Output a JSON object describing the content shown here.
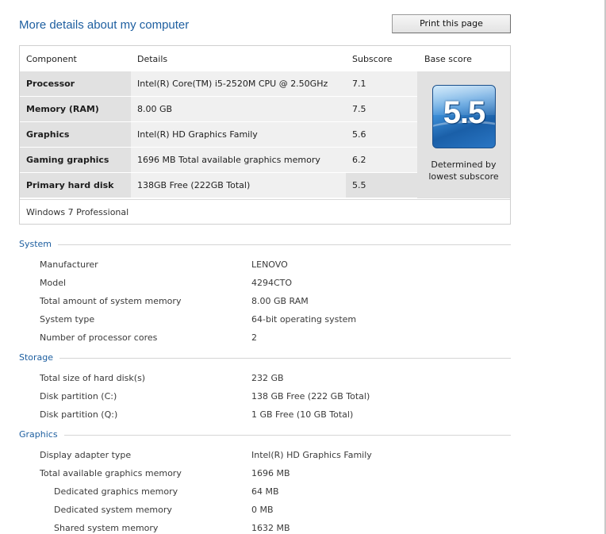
{
  "header": {
    "title": "More details about my computer",
    "print_label": "Print this page"
  },
  "score_table": {
    "columns": [
      "Component",
      "Details",
      "Subscore",
      "Base score"
    ],
    "rows": [
      {
        "component": "Processor",
        "details": "Intel(R) Core(TM) i5-2520M CPU @ 2.50GHz",
        "subscore": "7.1"
      },
      {
        "component": "Memory (RAM)",
        "details": "8.00 GB",
        "subscore": "7.5"
      },
      {
        "component": "Graphics",
        "details": "Intel(R) HD Graphics Family",
        "subscore": "5.6"
      },
      {
        "component": "Gaming graphics",
        "details": "1696 MB Total available graphics memory",
        "subscore": "6.2"
      },
      {
        "component": "Primary hard disk",
        "details": "138GB Free (222GB Total)",
        "subscore": "5.5"
      }
    ],
    "base_score": "5.5",
    "base_caption_line1": "Determined by",
    "base_caption_line2": "lowest subscore",
    "edition": "Windows 7 Professional"
  },
  "sections": {
    "system": {
      "title": "System",
      "rows": [
        {
          "key": "Manufacturer",
          "value": "LENOVO"
        },
        {
          "key": "Model",
          "value": "4294CTO"
        },
        {
          "key": "Total amount of system memory",
          "value": "8.00 GB RAM"
        },
        {
          "key": "System type",
          "value": "64-bit operating system"
        },
        {
          "key": "Number of processor cores",
          "value": "2"
        }
      ]
    },
    "storage": {
      "title": "Storage",
      "rows": [
        {
          "key": "Total size of hard disk(s)",
          "value": "232 GB"
        },
        {
          "key": "Disk partition (C:)",
          "value": "138 GB Free (222 GB Total)"
        },
        {
          "key": "Disk partition (Q:)",
          "value": "1 GB Free (10 GB Total)"
        }
      ]
    },
    "graphics": {
      "title": "Graphics",
      "rows": [
        {
          "key": "Display adapter type",
          "value": "Intel(R) HD Graphics Family"
        },
        {
          "key": "Total available graphics memory",
          "value": "1696 MB"
        },
        {
          "key": "Dedicated graphics memory",
          "value": "64 MB"
        },
        {
          "key": "Dedicated system memory",
          "value": "0 MB"
        },
        {
          "key": "Shared system memory",
          "value": "1632 MB"
        }
      ]
    }
  },
  "colors": {
    "accent": "#1e5fa0",
    "row_dark": "#e1e1e1",
    "row_light": "#f0f0f0"
  }
}
